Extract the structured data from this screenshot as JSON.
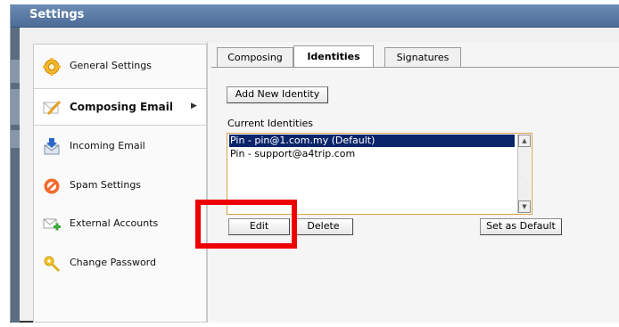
{
  "window": {
    "title": "Settings"
  },
  "sidebar": {
    "items": [
      {
        "label": "General Settings",
        "icon": "gear-icon",
        "active": false
      },
      {
        "label": "Composing Email",
        "icon": "compose-pencil-icon",
        "active": true
      },
      {
        "label": "Incoming Email",
        "icon": "incoming-mail-icon",
        "active": false
      },
      {
        "label": "Spam Settings",
        "icon": "no-spam-icon",
        "active": false
      },
      {
        "label": "External Accounts",
        "icon": "add-account-icon",
        "active": false
      },
      {
        "label": "Change Password",
        "icon": "key-icon",
        "active": false
      }
    ]
  },
  "tabs": [
    {
      "label": "Composing",
      "active": false
    },
    {
      "label": "Identities",
      "active": true
    },
    {
      "label": "Signatures",
      "active": false
    }
  ],
  "identities": {
    "add_button": "Add New Identity",
    "list_label": "Current Identities",
    "items": [
      {
        "text": "Pin - pin@1.com.my (Default)",
        "selected": true
      },
      {
        "text": "Pin - support@a4trip.com",
        "selected": false
      }
    ],
    "edit_button": "Edit",
    "delete_button": "Delete",
    "default_button": "Set as Default"
  },
  "colors": {
    "titlebar": "#5678a5",
    "selection": "#0a246a",
    "highlight_box": "#ee0000",
    "listbox_border": "#d5a24a"
  }
}
